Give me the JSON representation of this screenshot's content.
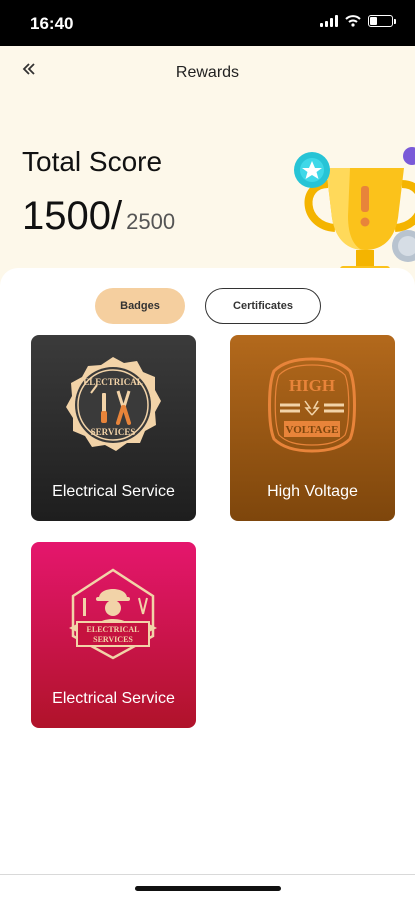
{
  "status_bar": {
    "time": "16:40"
  },
  "header": {
    "back_icon": "double-chevron-left-icon",
    "title": "Rewards"
  },
  "score": {
    "label": "Total Score",
    "value": "1500",
    "separator": "/",
    "total": "2500"
  },
  "tabs": [
    {
      "label": "Badges",
      "selected": true
    },
    {
      "label": "Certificates",
      "selected": false
    }
  ],
  "badges": [
    {
      "label": "Electrical Service",
      "emblem": "electrical-services-seal-icon",
      "color": "#2b2b2b"
    },
    {
      "label": "High Voltage",
      "emblem": "high-voltage-seal-icon",
      "color": "#9a5714"
    },
    {
      "label": "Electrical Service",
      "emblem": "electrician-shield-icon",
      "color": "#d0144f"
    }
  ],
  "emblems": {
    "electrical_line1": "ELECTRICAL",
    "electrical_line2": "SERVICES",
    "voltage_line1": "HIGH",
    "voltage_line2": "VOLTAGE"
  },
  "colors": {
    "header_bg": "#fdf8ea",
    "tab_active": "#f5cf9f",
    "emblem_cream": "#f2d3a8",
    "emblem_orange": "#e8843a"
  }
}
